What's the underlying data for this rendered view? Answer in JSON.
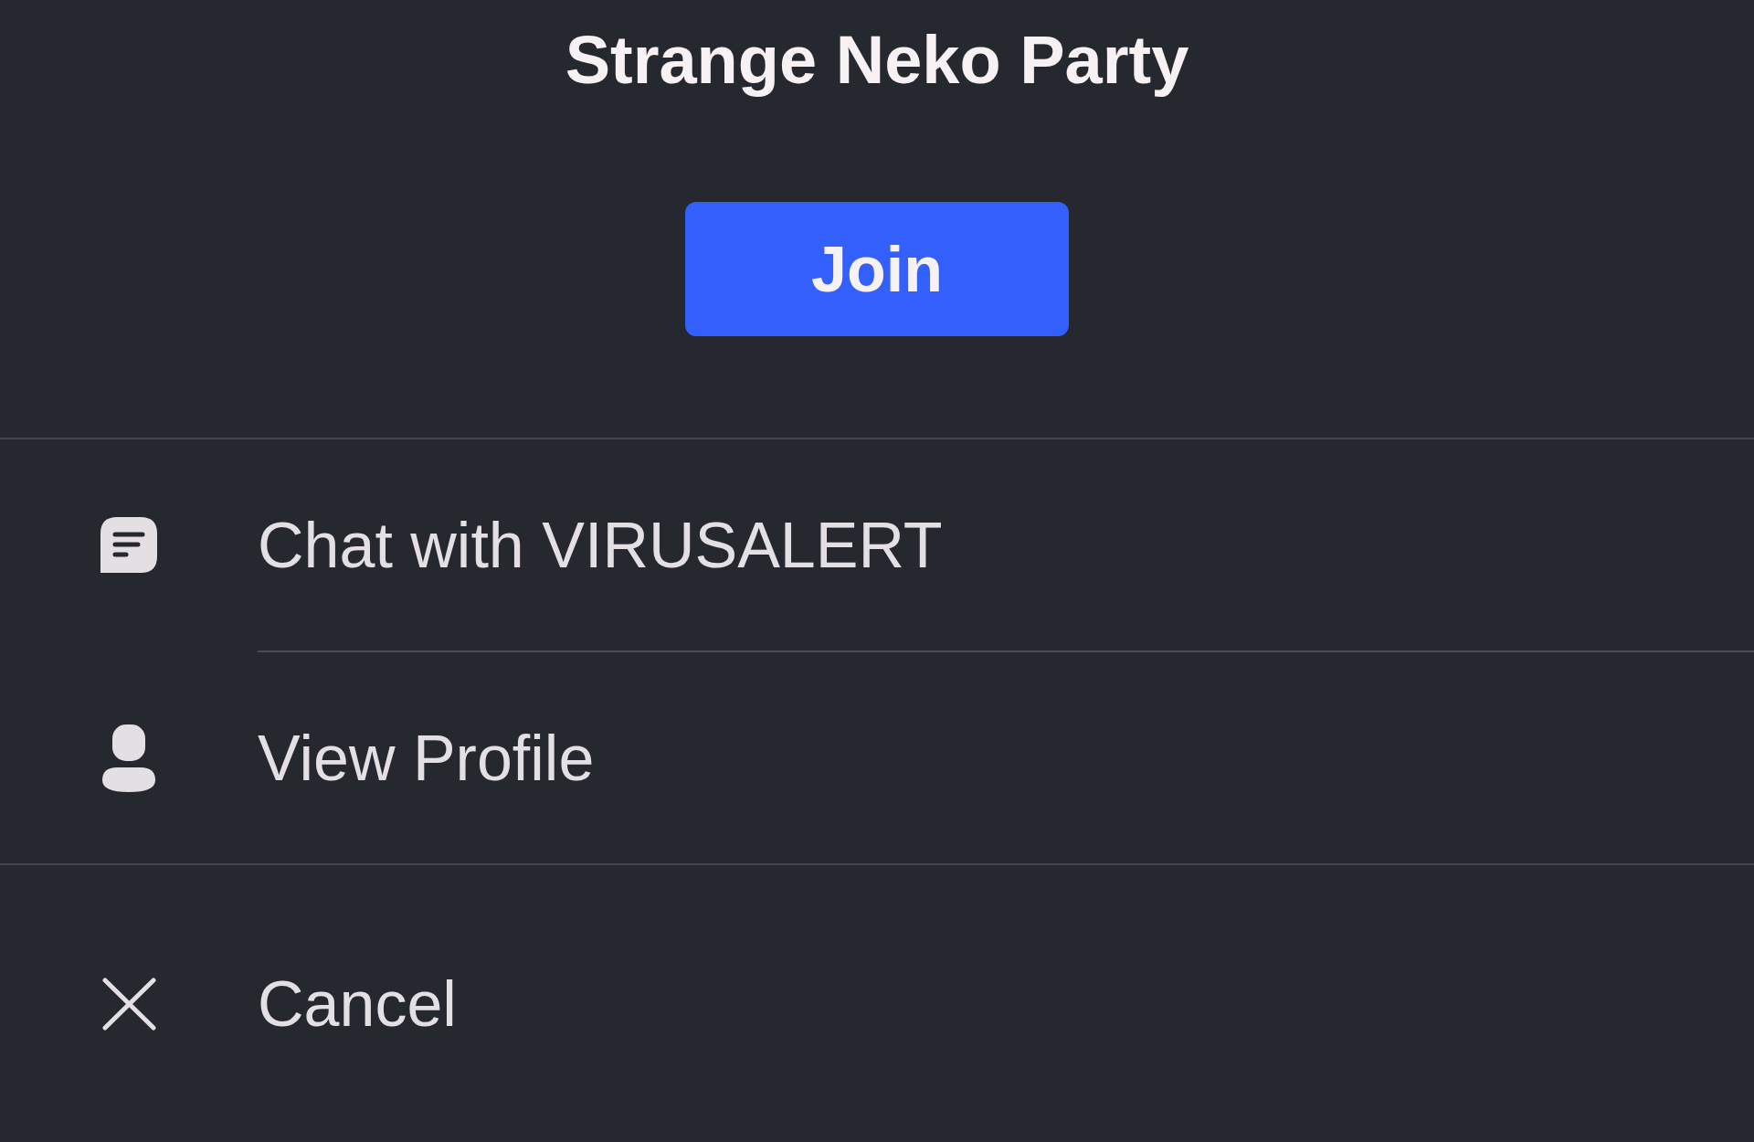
{
  "title": "Strange Neko Party",
  "join_button": {
    "label": "Join"
  },
  "action_groups": [
    {
      "items": [
        {
          "kind": "chat",
          "label": "Chat with VIRUSALERT"
        },
        {
          "kind": "profile",
          "label": "View Profile"
        }
      ]
    },
    {
      "items": [
        {
          "kind": "cancel",
          "label": "Cancel"
        }
      ]
    }
  ]
}
